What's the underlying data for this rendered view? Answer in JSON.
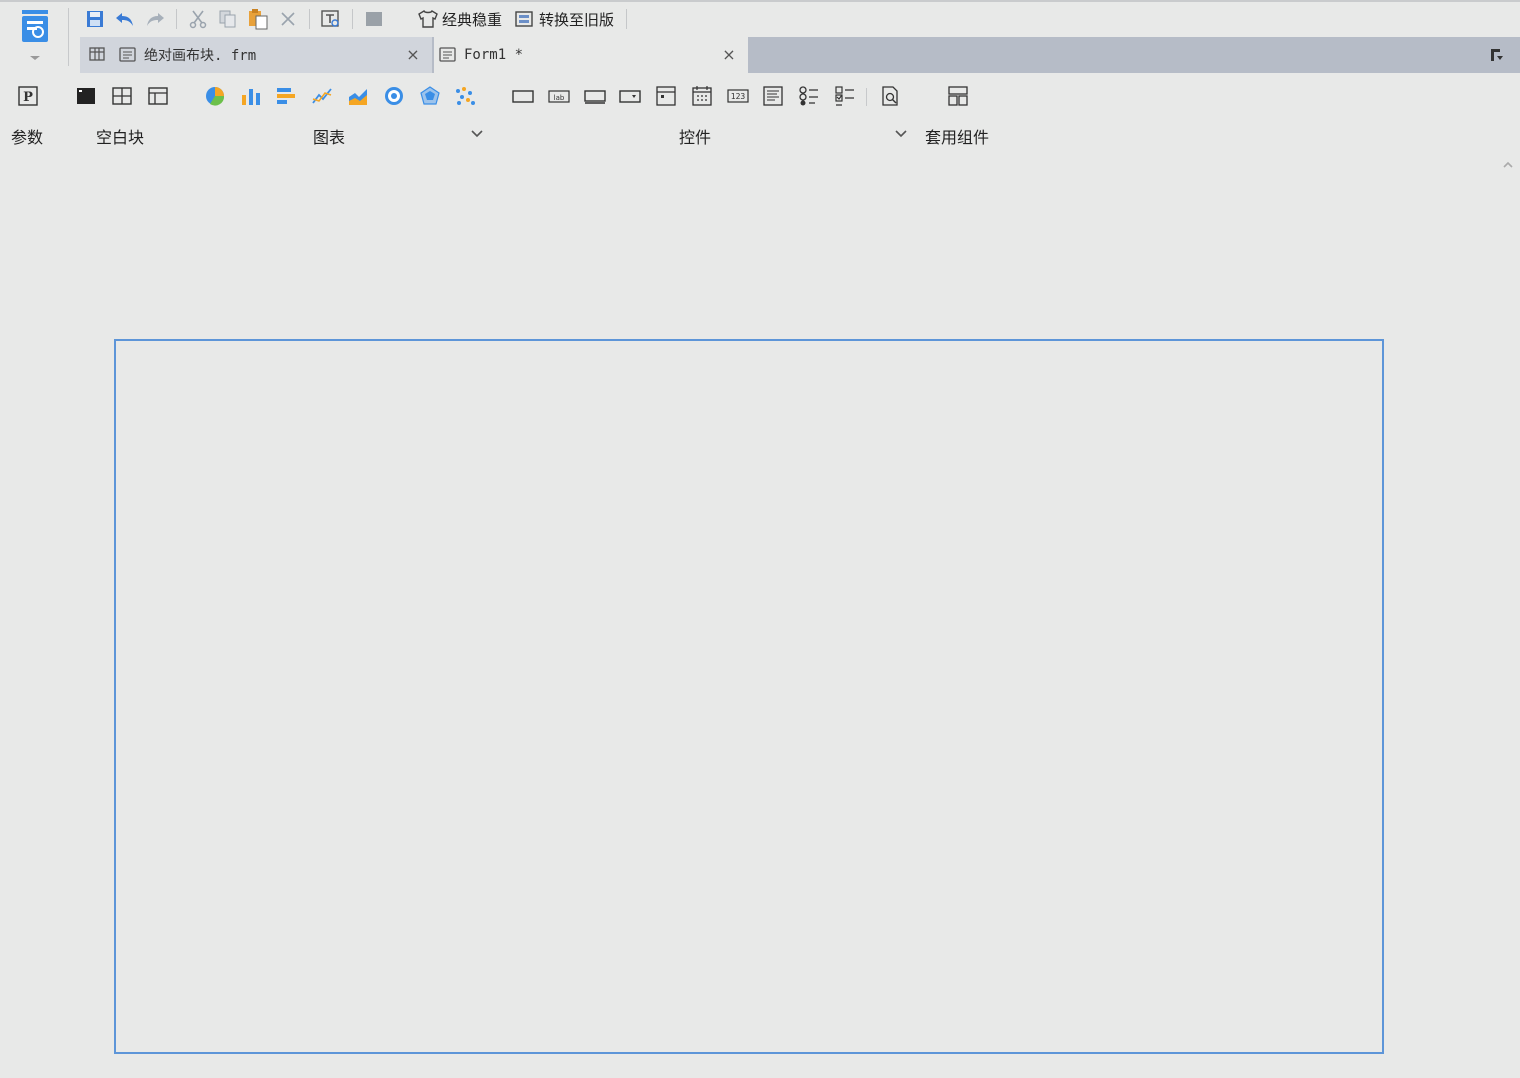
{
  "quick_toolbar": {
    "theme_label": "经典稳重",
    "switch_label": "转换至旧版"
  },
  "tabs": [
    {
      "label": "绝对画布块. frm",
      "close": "×"
    },
    {
      "label": "Form1 *",
      "close": "×"
    }
  ],
  "ribbon": {
    "groups": {
      "params": "参数",
      "blank_block": "空白块",
      "chart": "图表",
      "widget": "控件",
      "template_component": "套用组件"
    }
  },
  "colors": {
    "accent": "#5d95d8",
    "tab_active": "#d1d5dc",
    "tabbar": "#b6bcc7",
    "background": "#e8e9e8"
  }
}
